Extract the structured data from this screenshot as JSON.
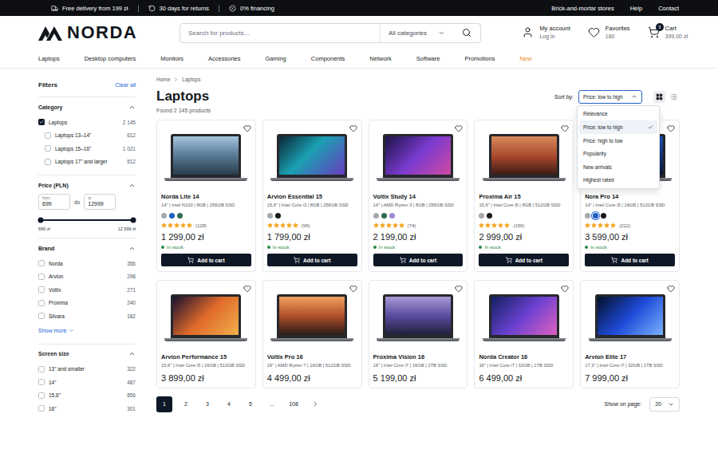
{
  "top_bar": {
    "perks": [
      "Free delivery from 199 zł",
      "30 days for returns",
      "0% financing"
    ],
    "links": [
      "Brick-and-mortar stores",
      "Help",
      "Contact"
    ]
  },
  "header": {
    "logo": "NORDA",
    "search": {
      "placeholder": "Search for products...",
      "category": "All categories"
    },
    "account": {
      "label": "My account",
      "sub": "Log in"
    },
    "favorites": {
      "label": "Favorites",
      "sub": "160"
    },
    "cart": {
      "label": "Cart",
      "sub": "399,00 zł",
      "badge": "3"
    }
  },
  "nav": [
    {
      "label": "Laptops",
      "highlight": false
    },
    {
      "label": "Desktop computers",
      "highlight": false
    },
    {
      "label": "Monitors",
      "highlight": false
    },
    {
      "label": "Accessories",
      "highlight": false
    },
    {
      "label": "Gaming",
      "highlight": false
    },
    {
      "label": "Components",
      "highlight": false
    },
    {
      "label": "Network",
      "highlight": false
    },
    {
      "label": "Software",
      "highlight": false
    },
    {
      "label": "Promotions",
      "highlight": false
    },
    {
      "label": "New",
      "highlight": true
    }
  ],
  "filters": {
    "title": "Filters",
    "clear": "Clear all",
    "category": {
      "title": "Category",
      "expanded": true,
      "items": [
        {
          "label": "Laptops",
          "count": "2 145",
          "checked": true,
          "kind": "parent"
        },
        {
          "label": "Laptops 13–14\"",
          "count": "612",
          "checked": false,
          "kind": "child"
        },
        {
          "label": "Laptops 15–16\"",
          "count": "1 021",
          "checked": false,
          "kind": "child"
        },
        {
          "label": "Laptops 17\" and larger",
          "count": "512",
          "checked": false,
          "kind": "child"
        }
      ]
    },
    "price": {
      "title": "Price (PLN)",
      "expanded": true,
      "from_label": "from",
      "from": "699",
      "separator": "do",
      "to_label": "to",
      "to": "12999",
      "min_label": "699 zł",
      "max_label": "12 999 zł",
      "low": 0,
      "high": 1
    },
    "brand": {
      "title": "Brand",
      "expanded": true,
      "items": [
        {
          "label": "Norda",
          "count": "356",
          "checked": false,
          "kind": "parent"
        },
        {
          "label": "Arvion",
          "count": "298",
          "checked": false,
          "kind": "parent"
        },
        {
          "label": "Voltix",
          "count": "271",
          "checked": false,
          "kind": "parent"
        },
        {
          "label": "Proxima",
          "count": "240",
          "checked": false,
          "kind": "parent"
        },
        {
          "label": "Silvara",
          "count": "182",
          "checked": false,
          "kind": "parent"
        }
      ],
      "more": "Show more"
    },
    "screen_size": {
      "title": "Screen size",
      "expanded": true,
      "items": [
        {
          "label": "13\" and smaller",
          "count": "322",
          "checked": false,
          "kind": "parent"
        },
        {
          "label": "14\"",
          "count": "487",
          "checked": false,
          "kind": "parent"
        },
        {
          "label": "15,6\"",
          "count": "856",
          "checked": false,
          "kind": "parent"
        },
        {
          "label": "16\"",
          "count": "301",
          "checked": false,
          "kind": "parent"
        }
      ]
    }
  },
  "breadcrumb": [
    "Home",
    "Laptops"
  ],
  "title": "Laptops",
  "found": "Found 2 145 products",
  "sort": {
    "label": "Sort by:",
    "value": "Price: low to high",
    "open": true,
    "options": [
      {
        "label": "Relevance",
        "selected": false
      },
      {
        "label": "Price: low to high",
        "selected": true
      },
      {
        "label": "Price: high to low",
        "selected": false
      },
      {
        "label": "Popularity",
        "selected": false
      },
      {
        "label": "New arrivals",
        "selected": false
      },
      {
        "label": "Highest rated",
        "selected": false
      }
    ]
  },
  "view": [
    {
      "kind": "grid",
      "selected": true
    },
    {
      "kind": "list",
      "selected": false
    }
  ],
  "products": [
    {
      "name": "Norda Lite 14",
      "specs": "14\" | Intel N100 | 8GB | 256GB SSD",
      "favorite": false,
      "colors": [
        {
          "color": "#a5a8ae",
          "selected": false
        },
        {
          "color": "#1f5fbf",
          "selected": false
        },
        {
          "color": "#2f6b4f",
          "selected": false
        }
      ],
      "stars": 5,
      "reviews": "(128)",
      "price": "1 299,00 zł",
      "stock": "In stock",
      "button": "Add to cart"
    },
    {
      "name": "Arvion Essential 15",
      "specs": "15,6\" | Intel Core i3 | 8GB | 256GB SSD",
      "favorite": false,
      "colors": [
        {
          "color": "#a5a8ae",
          "selected": false
        },
        {
          "color": "#1a1a1a",
          "selected": false
        }
      ],
      "stars": 5,
      "reviews": "(96)",
      "price": "1 799,00 zł",
      "stock": "In stock",
      "button": "Add to cart"
    },
    {
      "name": "Voltix Study 14",
      "specs": "14\" | AMD Ryzen 3 | 8GB | 256GB SSD",
      "favorite": false,
      "colors": [
        {
          "color": "#a5a8ae",
          "selected": false
        },
        {
          "color": "#2f6b4f",
          "selected": false
        },
        {
          "color": "#a08ad6",
          "selected": false
        }
      ],
      "stars": 5,
      "reviews": "(74)",
      "price": "2 199,00 zł",
      "stock": "In stock",
      "button": "Add to cart"
    },
    {
      "name": "Proxima Air 15",
      "specs": "15,6\" | Intel Core i5 | 8GB | 512GB SSD",
      "favorite": false,
      "colors": [
        {
          "color": "#a5a8ae",
          "selected": false
        },
        {
          "color": "#1a1a1a",
          "selected": false
        }
      ],
      "stars": 5,
      "reviews": "(156)",
      "price": "2 999,00 zł",
      "stock": "In stock",
      "button": "Add to cart"
    },
    {
      "name": "Nora Pro 14",
      "specs": "14\" | Intel Core i5 | 16GB | 512GB SSD",
      "favorite": false,
      "colors": [
        {
          "color": "#a5a8ae",
          "selected": false
        },
        {
          "color": "#1f5fbf",
          "selected": true
        },
        {
          "color": "#1a1a1a",
          "selected": false
        }
      ],
      "stars": 5,
      "reviews": "(212)",
      "price": "3 599,00 zł",
      "stock": "In stock",
      "button": "Add to cart"
    },
    {
      "name": "Arvion Performance 15",
      "specs": "15,6\" | Intel Core i5 | 16GB | 512GB SSD",
      "favorite": false,
      "price": "3 899,00 zł"
    },
    {
      "name": "Voltix Pro 16",
      "specs": "16\" | AMD Ryzen 7 | 16GB | 512GB SSD",
      "favorite": false,
      "price": "4 499,00 zł"
    },
    {
      "name": "Proxima Vision 16",
      "specs": "16\" | Intel Core i7 | 16GB | 1TB SSD",
      "favorite": false,
      "price": "5 199,00 zł"
    },
    {
      "name": "Norda Creator 16",
      "specs": "16\" | Intel Core i7 | 32GB | 1TB SSD",
      "favorite": false,
      "price": "6 499,00 zł"
    },
    {
      "name": "Arvion Elite 17",
      "specs": "17,3\" | Intel Core i7 | 32GB | 1TB SSD",
      "favorite": false,
      "price": "7 999,00 zł"
    }
  ],
  "pagination": {
    "pages": [
      {
        "label": "1",
        "selected": true
      },
      {
        "label": "2",
        "selected": false
      },
      {
        "label": "3",
        "selected": false
      },
      {
        "label": "4",
        "selected": false
      },
      {
        "label": "5",
        "selected": false
      },
      {
        "label": "...",
        "selected": false
      },
      {
        "label": "108",
        "selected": false
      }
    ],
    "per_page_label": "Show on page:",
    "per_page": "20"
  }
}
